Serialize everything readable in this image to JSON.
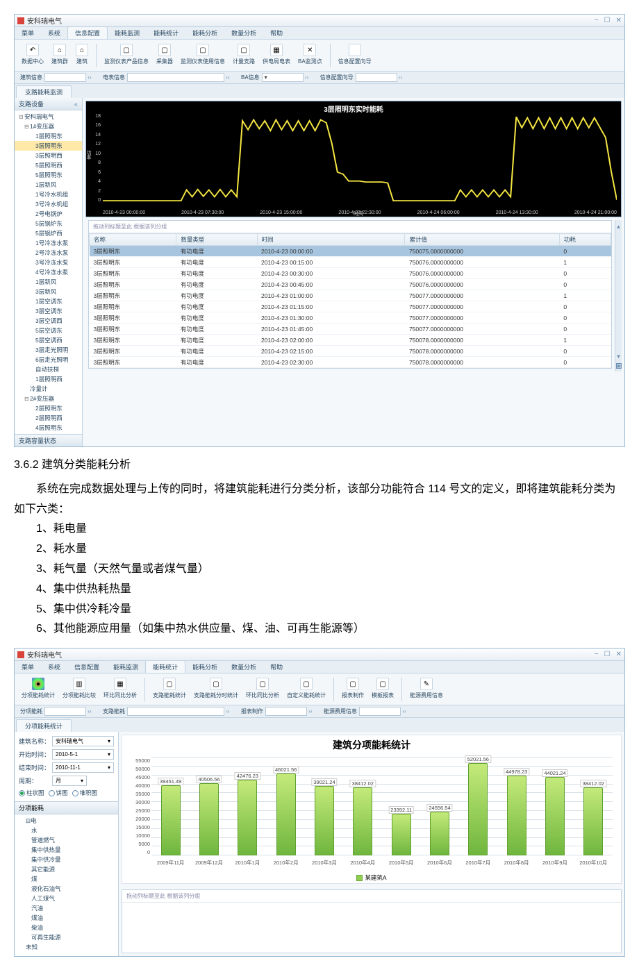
{
  "app1": {
    "title": "安科瑞电气",
    "window_controls": [
      "−",
      "☐",
      "✕"
    ],
    "menus": [
      "菜单",
      "系统",
      "信息配置",
      "能耗监测",
      "能耗统计",
      "能耗分析",
      "数量分析",
      "帮助"
    ],
    "active_menu": "信息配置",
    "ribbon": [
      {
        "icon": "↶",
        "label": "数据中心"
      },
      {
        "icon": "⌂",
        "label": "建筑群"
      },
      {
        "icon": "⌂",
        "label": "建筑"
      },
      {
        "icon": "sep"
      },
      {
        "icon": "▢",
        "label": "监测仪表产品信息"
      },
      {
        "icon": "▢",
        "label": "采集器"
      },
      {
        "icon": "▢",
        "label": "监测仪表使用信息"
      },
      {
        "icon": "▢",
        "label": "计量支路"
      },
      {
        "icon": "▦",
        "label": "供电局电表"
      },
      {
        "icon": "✕",
        "label": "BA监测点"
      },
      {
        "icon": "sep"
      },
      {
        "icon": "",
        "label": "信息配置向导"
      }
    ],
    "subbar": [
      {
        "label": "建筑信息",
        "value": "",
        "caret": true
      },
      {
        "label": "电表信息",
        "value": "",
        "caret": true,
        "wide": true
      },
      {
        "label": "BA信息",
        "value": "▾",
        "caret": true
      },
      {
        "label": "信息配置向导",
        "value": "",
        "caret": true
      }
    ],
    "tab": "支路能耗监测",
    "sidebar": {
      "header": "支路设备",
      "footer": "支路容量状态",
      "tree": [
        {
          "t": "安科瑞电气",
          "lvl": 0,
          "exp": "⊟"
        },
        {
          "t": "1#变压器",
          "lvl": 1,
          "exp": "⊟"
        },
        {
          "t": "1层照明东",
          "lvl": 2
        },
        {
          "t": "3层照明东",
          "lvl": 2,
          "sel": true
        },
        {
          "t": "3层照明西",
          "lvl": 2
        },
        {
          "t": "5层照明西",
          "lvl": 2
        },
        {
          "t": "5层照明东",
          "lvl": 2
        },
        {
          "t": "1层新风",
          "lvl": 2
        },
        {
          "t": "1号冷水机组",
          "lvl": 2
        },
        {
          "t": "3号冷水机组",
          "lvl": 2
        },
        {
          "t": "2号电锅炉",
          "lvl": 2
        },
        {
          "t": "5层锅炉东",
          "lvl": 2
        },
        {
          "t": "5层锅炉西",
          "lvl": 2
        },
        {
          "t": "1号冷冻水泵",
          "lvl": 2
        },
        {
          "t": "2号冷冻水泵",
          "lvl": 2
        },
        {
          "t": "3号冷冻水泵",
          "lvl": 2
        },
        {
          "t": "4号冷冻水泵",
          "lvl": 2
        },
        {
          "t": "1层新风",
          "lvl": 2
        },
        {
          "t": "3层新风",
          "lvl": 2
        },
        {
          "t": "1层空调东",
          "lvl": 2
        },
        {
          "t": "3层空调东",
          "lvl": 2
        },
        {
          "t": "3层空调西",
          "lvl": 2
        },
        {
          "t": "5层空调东",
          "lvl": 2
        },
        {
          "t": "5层空调西",
          "lvl": 2
        },
        {
          "t": "3层走光照明",
          "lvl": 2
        },
        {
          "t": "6层走光照明",
          "lvl": 2
        },
        {
          "t": "自动扶梯",
          "lvl": 2
        },
        {
          "t": "1层照明西",
          "lvl": 2
        },
        {
          "t": "冷量计",
          "lvl": 1
        },
        {
          "t": "2#变压器",
          "lvl": 1,
          "exp": "⊟"
        },
        {
          "t": "2层照明东",
          "lvl": 2
        },
        {
          "t": "2层照明西",
          "lvl": 2
        },
        {
          "t": "4层照明东",
          "lvl": 2
        }
      ]
    },
    "grid": {
      "hint": "拖动列标题至此 根据该列分组",
      "cols": [
        "名称",
        "数量类型",
        "时间",
        "累计值",
        "功耗"
      ],
      "rows": [
        [
          "3层照明东",
          "有功电度",
          "2010-4-23 00:00:00",
          "750075.0000000000",
          "0",
          true
        ],
        [
          "3层照明东",
          "有功电度",
          "2010-4-23 00:15:00",
          "750076.0000000000",
          "1"
        ],
        [
          "3层照明东",
          "有功电度",
          "2010-4-23 00:30:00",
          "750076.0000000000",
          "0"
        ],
        [
          "3层照明东",
          "有功电度",
          "2010-4-23 00:45:00",
          "750076.0000000000",
          "0"
        ],
        [
          "3层照明东",
          "有功电度",
          "2010-4-23 01:00:00",
          "750077.0000000000",
          "1"
        ],
        [
          "3层照明东",
          "有功电度",
          "2010-4-23 01:15:00",
          "750077.0000000000",
          "0"
        ],
        [
          "3层照明东",
          "有功电度",
          "2010-4-23 01:30:00",
          "750077.0000000000",
          "0"
        ],
        [
          "3层照明东",
          "有功电度",
          "2010-4-23 01:45:00",
          "750077.0000000000",
          "0"
        ],
        [
          "3层照明东",
          "有功电度",
          "2010-4-23 02:00:00",
          "750078.0000000000",
          "1"
        ],
        [
          "3层照明东",
          "有功电度",
          "2010-4-23 02:15:00",
          "750078.0000000000",
          "0"
        ],
        [
          "3层照明东",
          "有功电度",
          "2010-4-23 02:30:00",
          "750078.0000000000",
          "0"
        ]
      ]
    }
  },
  "chart_data": [
    {
      "type": "line",
      "title": "3层照明东实时能耗",
      "ylabel": "功率",
      "xlabel": "时间",
      "x_ticks": [
        "2010-4-23 00:00:00",
        "2010-4-23 07:30:00",
        "2010-4-23 15:00:00",
        "2010-4-23 22:30:00",
        "2010-4-24 06:00:00",
        "2010-4-24 13:30:00",
        "2010-4-24 21:00:00"
      ],
      "y_ticks": [
        0,
        2,
        4,
        6,
        8,
        10,
        12,
        14,
        16,
        18
      ],
      "ylim": [
        0,
        18
      ],
      "color": "#f5e642",
      "points_approx": [
        [
          0,
          0.4
        ],
        [
          14,
          0.4
        ],
        [
          15,
          2.6
        ],
        [
          16,
          1.2
        ],
        [
          17,
          2.7
        ],
        [
          18,
          1.3
        ],
        [
          19,
          2.6
        ],
        [
          20,
          1.2
        ],
        [
          21,
          2.7
        ],
        [
          22,
          1.2
        ],
        [
          23,
          2.6
        ],
        [
          24,
          1.2
        ],
        [
          25,
          16.6
        ],
        [
          26,
          14.8
        ],
        [
          27,
          16.8
        ],
        [
          28,
          15.0
        ],
        [
          29,
          16.6
        ],
        [
          30,
          14.6
        ],
        [
          31,
          16.8
        ],
        [
          32,
          14.8
        ],
        [
          33,
          16.6
        ],
        [
          34,
          14.6
        ],
        [
          35,
          16.6
        ],
        [
          36,
          14.6
        ],
        [
          37,
          16.6
        ],
        [
          38,
          14.6
        ],
        [
          39,
          16.8
        ],
        [
          40,
          16.2
        ],
        [
          41,
          12.0
        ],
        [
          42,
          6.2
        ],
        [
          43,
          5.8
        ],
        [
          44,
          4.4
        ],
        [
          45,
          4.4
        ],
        [
          46,
          4.4
        ],
        [
          47,
          4.2
        ],
        [
          48,
          4.2
        ],
        [
          49,
          4.2
        ],
        [
          50,
          4.2
        ],
        [
          51,
          4.0
        ],
        [
          52,
          0.4
        ],
        [
          53,
          0.4
        ],
        [
          63,
          0.4
        ],
        [
          64,
          2.6
        ],
        [
          65,
          1.2
        ],
        [
          66,
          2.6
        ],
        [
          67,
          1.2
        ],
        [
          68,
          2.6
        ],
        [
          69,
          1.2
        ],
        [
          70,
          2.6
        ],
        [
          71,
          1.2
        ],
        [
          72,
          2.6
        ],
        [
          73,
          1.2
        ],
        [
          74,
          17.4
        ],
        [
          75,
          15.2
        ],
        [
          76,
          17.2
        ],
        [
          77,
          15.0
        ],
        [
          78,
          17.2
        ],
        [
          79,
          15.0
        ],
        [
          80,
          17.2
        ],
        [
          81,
          15.0
        ],
        [
          82,
          17.2
        ],
        [
          83,
          15.0
        ],
        [
          84,
          17.2
        ],
        [
          85,
          15.0
        ],
        [
          86,
          17.2
        ],
        [
          87,
          15.2
        ],
        [
          88,
          17.2
        ],
        [
          89,
          15.2
        ],
        [
          90,
          13.2
        ],
        [
          91,
          6.4
        ],
        [
          92,
          0.6
        ]
      ]
    },
    {
      "type": "bar",
      "title": "建筑分项能耗统计",
      "categories": [
        "2009年11月",
        "2009年12月",
        "2010年1月",
        "2010年2月",
        "2010年3月",
        "2010年4月",
        "2010年5月",
        "2010年6月",
        "2010年7月",
        "2010年8月",
        "2010年9月",
        "2010年10月"
      ],
      "values": [
        39451.49,
        40506.56,
        42476.23,
        46021.56,
        39021.24,
        38412.02,
        23392.11,
        24556.54,
        52021.56,
        44978.23,
        44021.24,
        38412.02
      ],
      "y_ticks": [
        0,
        5000,
        10000,
        15000,
        20000,
        25000,
        30000,
        35000,
        40000,
        45000,
        50000,
        55000
      ],
      "ylim": [
        0,
        55000
      ],
      "legend": "某建筑A",
      "color": "#8fcf4f"
    }
  ],
  "doc": {
    "section": "3.6.2 建筑分类能耗分析",
    "para": "系统在完成数据处理与上传的同时，将建筑能耗进行分类分析，该部分功能符合 114 号文的定义，即将建筑能耗分类为如下六类：",
    "items": [
      "1、耗电量",
      "2、耗水量",
      "3、耗气量（天然气量或者煤气量）",
      "4、集中供热耗热量",
      "5、集中供冷耗冷量",
      "6、其他能源应用量（如集中热水供应量、煤、油、可再生能源等）"
    ]
  },
  "app2": {
    "title": "安科瑞电气",
    "menus": [
      "菜单",
      "系统",
      "信息配置",
      "能耗监测",
      "能耗统计",
      "能耗分析",
      "数量分析",
      "帮助"
    ],
    "active_menu": "能耗统计",
    "ribbon": [
      {
        "icon": "●",
        "label": "分项能耗统计",
        "cls": "color"
      },
      {
        "icon": "▥",
        "label": "分项能耗比较"
      },
      {
        "icon": "▦",
        "label": "环比同比分析"
      },
      {
        "icon": "sep"
      },
      {
        "icon": "▢",
        "label": "支路能耗统计"
      },
      {
        "icon": "▢",
        "label": "支路能耗分时统计"
      },
      {
        "icon": "▢",
        "label": "环比同比分析"
      },
      {
        "icon": "▢",
        "label": "自定义能耗统计"
      },
      {
        "icon": "sep"
      },
      {
        "icon": "▢",
        "label": "报表制作"
      },
      {
        "icon": "▢",
        "label": "模板报表"
      },
      {
        "icon": "sep"
      },
      {
        "icon": "✎",
        "label": "能源费用信息",
        "cls": "wand"
      }
    ],
    "subbar": [
      {
        "label": "分项能耗",
        "caret": true
      },
      {
        "label": "支路能耗",
        "caret": true,
        "wide": true
      },
      {
        "label": "报表制作",
        "caret": true
      },
      {
        "label": "能源费用信息",
        "caret": true
      }
    ],
    "tab": "分项能耗统计",
    "form": {
      "building_label": "建筑名称：",
      "building": "安科瑞电气",
      "start_label": "开始时间：",
      "start": "2010-5-1",
      "end_label": "结束时间：",
      "end": "2010-11-1",
      "cycle_label": "周期：",
      "cycle": "月",
      "radios": [
        "柱状图",
        "饼图",
        "堆积图"
      ],
      "radio_sel": 0
    },
    "tree_header": "分项能耗",
    "tree": [
      {
        "t": "电",
        "lvl": 0,
        "exp": "⊟"
      },
      {
        "t": "水",
        "lvl": 1
      },
      {
        "t": "管道燃气",
        "lvl": 1
      },
      {
        "t": "集中供热量",
        "lvl": 1
      },
      {
        "t": "集中供冷量",
        "lvl": 1
      },
      {
        "t": "其它能源",
        "lvl": 1
      },
      {
        "t": "煤",
        "lvl": 1
      },
      {
        "t": "液化石油气",
        "lvl": 1
      },
      {
        "t": "人工煤气",
        "lvl": 1
      },
      {
        "t": "汽油",
        "lvl": 1
      },
      {
        "t": "煤油",
        "lvl": 1
      },
      {
        "t": "柴油",
        "lvl": 1
      },
      {
        "t": "可再生能源",
        "lvl": 1
      },
      {
        "t": "未知",
        "lvl": 0
      }
    ],
    "gridhint": "拖动列标题至此 根据该列分组"
  }
}
